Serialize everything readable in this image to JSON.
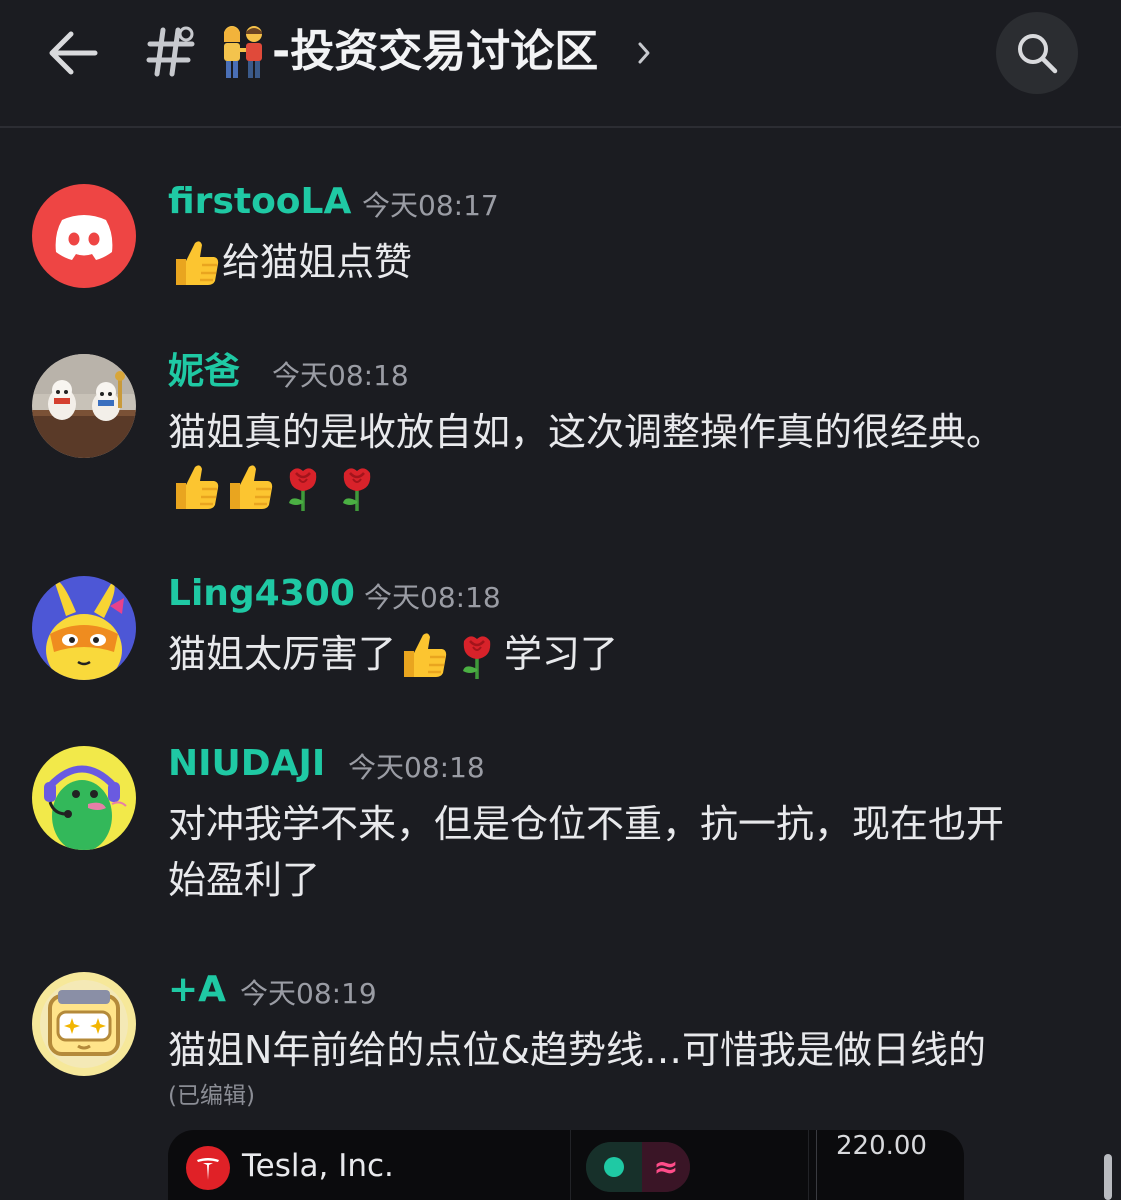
{
  "header": {
    "back_icon": "arrow-left-icon",
    "channel_icon": "text-channel-hash-icon",
    "channel_emoji": "couple-holding-hands-emoji",
    "channel_name": "-投资交易讨论区",
    "chevron_icon": "chevron-right-icon",
    "search_icon": "search-icon"
  },
  "messages": [
    {
      "username": "firstooLA",
      "timestamp": "今天08:17",
      "avatar": "discord-default-avatar-red",
      "lines": [
        {
          "emoji_before": "thumbs-up-emoji",
          "text": " 给猫姐点赞"
        }
      ]
    },
    {
      "username": "妮爸",
      "timestamp": "今天08:18",
      "avatar": "lucky-cat-figurines-photo",
      "lines": [
        {
          "text": "猫姐真的是收放自如，这次调整操作真的很经典。"
        },
        {
          "emojis": [
            "thumbs-up-emoji",
            "thumbs-up-emoji",
            "rose-emoji",
            "rose-emoji"
          ]
        }
      ]
    },
    {
      "username": "Ling4300",
      "timestamp": "今天08:18",
      "avatar": "bunny-mask-avatar",
      "lines": [
        {
          "text_a": "猫姐太厉害了",
          "emojis": [
            "thumbs-up-emoji",
            "rose-emoji"
          ],
          "text_b": "学习了"
        }
      ]
    },
    {
      "username": "NIUDAJI",
      "timestamp": "今天08:18",
      "avatar": "green-character-headset-avatar",
      "lines": [
        {
          "text": "对冲我学不来，但是仓位不重，抗一抗，现在也开"
        },
        {
          "text": "始盈利了"
        }
      ]
    },
    {
      "username": "+A",
      "timestamp": "今天08:19",
      "avatar": "robot-character-avatar",
      "lines": [
        {
          "text": "猫姐N年前给的点位&趋势线…可惜我是做日线的"
        }
      ],
      "edited": "(已编辑)"
    }
  ],
  "embed": {
    "company_logo": "tesla-logo-icon",
    "company_name": "Tesla, Inc.",
    "pill_left_icon": "green-dot-icon",
    "pill_right_symbol": "≈",
    "price_label": "220.00"
  },
  "colors": {
    "background": "#1b1c21",
    "username": "#1fc9a4",
    "timestamp": "#9a9ca4",
    "message_text": "#e8e9ec",
    "discord_red": "#ee4544"
  }
}
